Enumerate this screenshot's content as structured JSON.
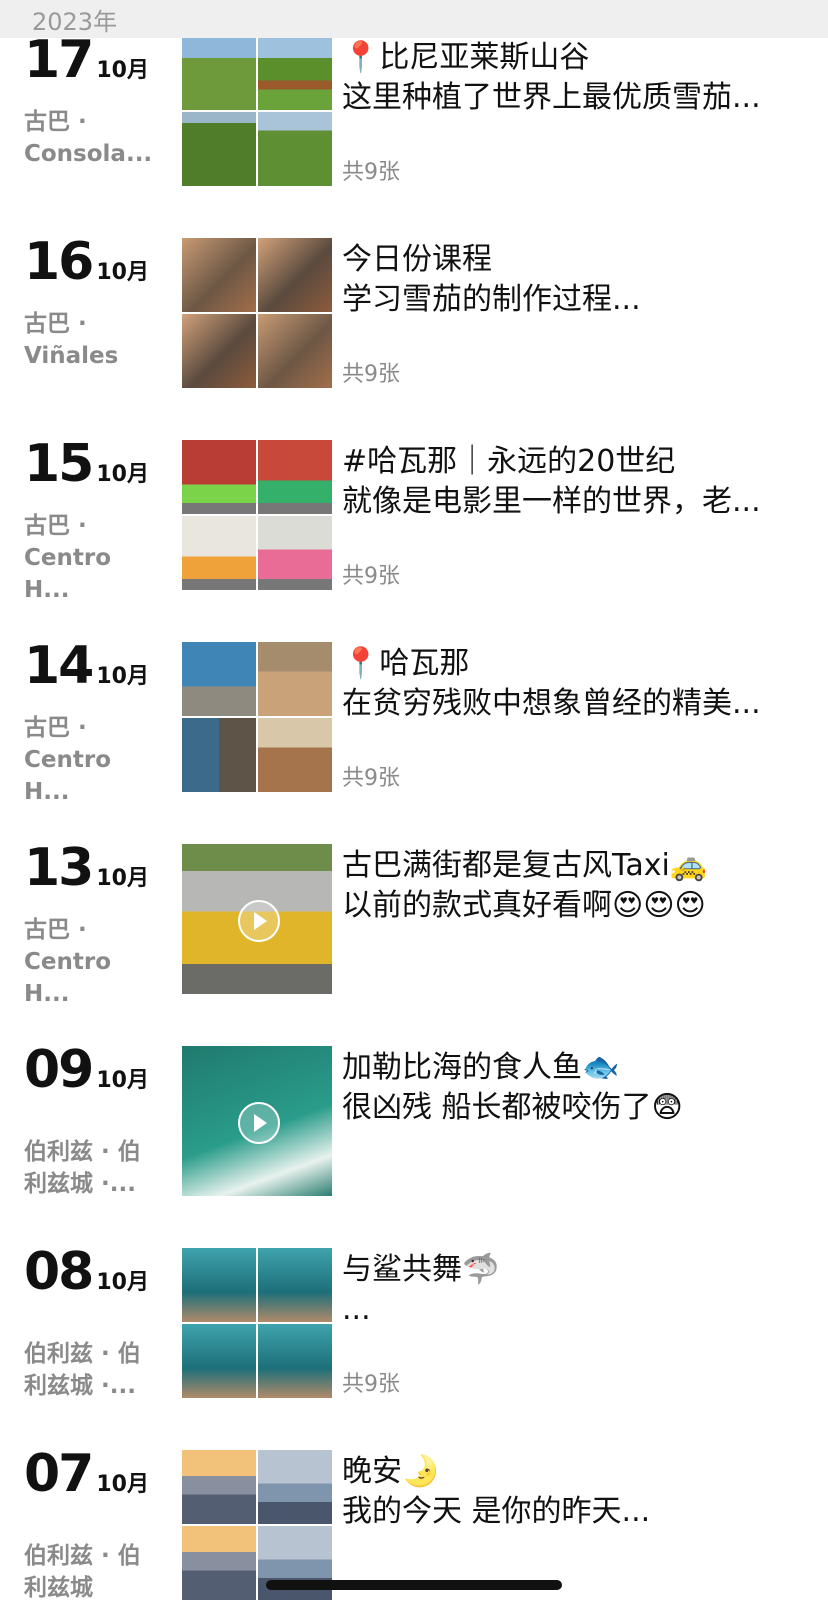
{
  "year_label": "2023年",
  "entries": [
    {
      "day": "17",
      "month": "10月",
      "location": "古巴 ·\nConsola...",
      "line1": "📍比尼亚莱斯山谷",
      "line2": "这里种植了世界上最优质雪茄...",
      "count": "共9张"
    },
    {
      "day": "16",
      "month": "10月",
      "location": "古巴 ·\nViñales",
      "line1": "今日份课程",
      "line2": "学习雪茄的制作过程...",
      "count": "共9张"
    },
    {
      "day": "15",
      "month": "10月",
      "location": "古巴 ·\nCentro H...",
      "line1": "#哈瓦那｜永远的20世纪",
      "line2": "就像是电影里一样的世界，老...",
      "count": "共9张"
    },
    {
      "day": "14",
      "month": "10月",
      "location": "古巴 ·\nCentro H...",
      "line1": "📍哈瓦那",
      "line2": "在贫穷残败中想象曾经的精美...",
      "count": "共9张"
    },
    {
      "day": "13",
      "month": "10月",
      "location": "古巴 ·\nCentro H...",
      "line1": "古巴满街都是复古风Taxi🚕",
      "line2": "以前的款式真好看啊😍😍😍",
      "count": ""
    },
    {
      "day": "09",
      "month": "10月",
      "location": "伯利兹 · 伯\n利兹城 ·...",
      "line1": "加勒比海的食人鱼🐟",
      "line2": "很凶残 船长都被咬伤了😨",
      "count": ""
    },
    {
      "day": "08",
      "month": "10月",
      "location": "伯利兹 · 伯\n利兹城 ·...",
      "line1": "与鲨共舞🦈",
      "line2": "...",
      "count": "共9张"
    },
    {
      "day": "07",
      "month": "10月",
      "location": "伯利兹 · 伯\n利兹城",
      "line1": "晚安🌛",
      "line2": "我的今天 是你的昨天...",
      "count": ""
    }
  ]
}
